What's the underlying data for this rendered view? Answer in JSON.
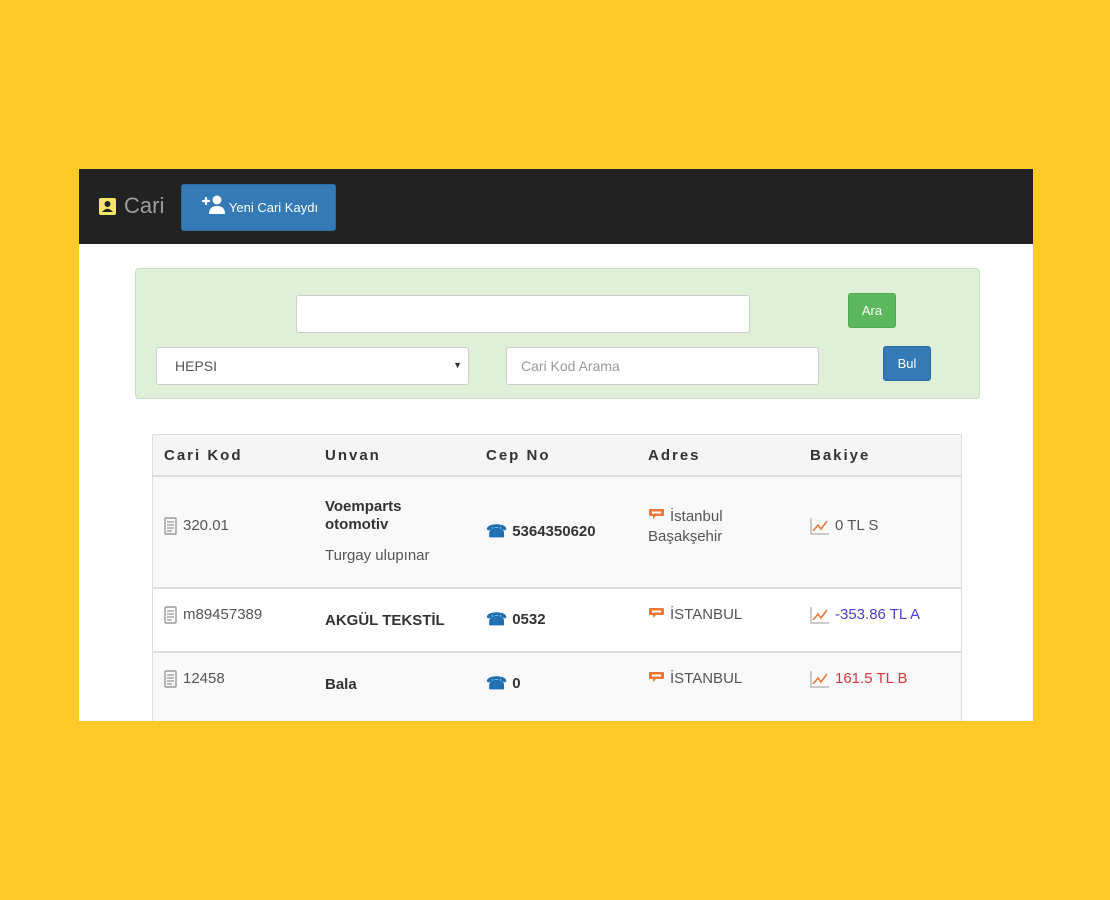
{
  "navbar": {
    "brand": "Cari",
    "new_button": "Yeni Cari Kaydı"
  },
  "search": {
    "main_value": "",
    "select_value": "HEPSI",
    "code_placeholder": "Cari Kod Arama",
    "ara_label": "Ara",
    "bul_label": "Bul"
  },
  "table": {
    "headers": [
      "Cari Kod",
      "Unvan",
      "Cep No",
      "Adres",
      "Bakiye"
    ],
    "rows": [
      {
        "code": "320.01",
        "title": "Voemparts otomotiv",
        "subtitle": "Turgay ulupınar",
        "phone": "5364350620",
        "address": "İstanbul Başakşehir",
        "balance": "0 TL S"
      },
      {
        "code": "m89457389",
        "title": "AKGÜL TEKSTİL",
        "subtitle": "",
        "phone": "0532",
        "address": "İSTANBUL",
        "balance": "-353.86 TL A"
      },
      {
        "code": "12458",
        "title": "Bala",
        "subtitle": "",
        "phone": "0",
        "address": "İSTANBUL",
        "balance": "161.5 TL B"
      }
    ]
  },
  "colors": {
    "page_background": "#FFCA28",
    "navbar": "#222222",
    "primary": "#337ab7",
    "success": "#5cb85c",
    "negative_balance": "#4b3fd6",
    "positive_balance": "#d9363e"
  },
  "icons": {
    "brand": "contact-card-icon",
    "new_button": "add-user-icon",
    "code": "document-icon",
    "phone": "phone-icon",
    "address": "speech-bubble-icon",
    "balance": "line-chart-icon"
  }
}
